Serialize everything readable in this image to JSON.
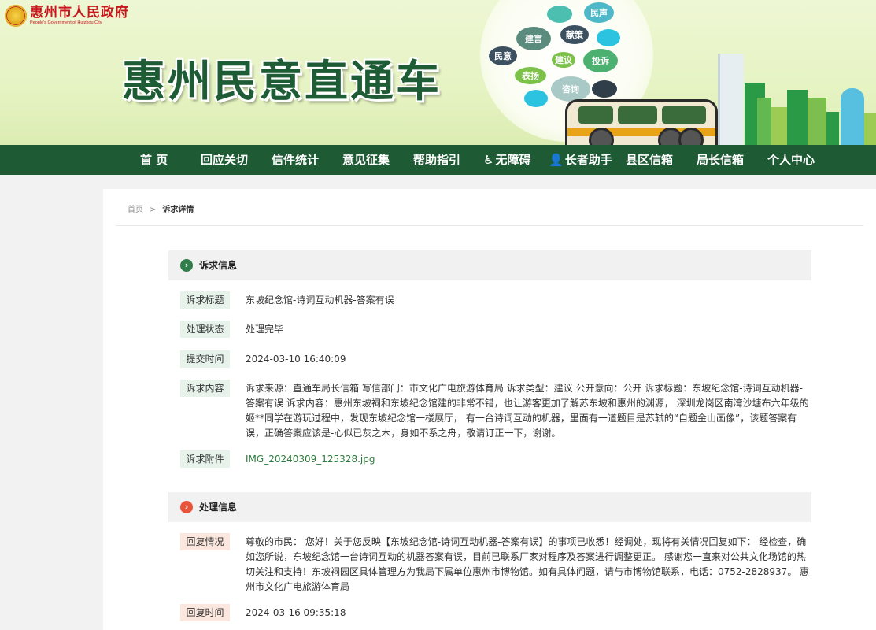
{
  "header": {
    "gov_name_cn": "惠州市人民政府",
    "gov_name_en": "People's Government of Huizhou City",
    "site_title": "惠州民意直通车",
    "bubbles": [
      "民声",
      "建言",
      "献策",
      "民意",
      "建议",
      "投诉",
      "表扬",
      "咨询"
    ]
  },
  "nav": {
    "items": [
      "首 页",
      "回应关切",
      "信件统计",
      "意见征集",
      "帮助指引",
      "无障碍",
      "长者助手",
      "县区信箱",
      "局长信箱",
      "个人中心"
    ]
  },
  "breadcrumb": {
    "home": "首页",
    "separator": ">",
    "current": "诉求详情"
  },
  "appeal": {
    "section_title": "诉求信息",
    "title_label": "诉求标题",
    "title_value": "东坡纪念馆-诗词互动机器-答案有误",
    "status_label": "处理状态",
    "status_value": "处理完毕",
    "submit_label": "提交时间",
    "submit_value": "2024-03-10 16:40:09",
    "content_label": "诉求内容",
    "content_value": "诉求来源：直通车局长信箱 写信部门：市文化广电旅游体育局 诉求类型：建议 公开意向：公开 诉求标题：东坡纪念馆-诗词互动机器-答案有误 诉求内容：惠州东坡祠和东坡纪念馆建的非常不错，也让游客更加了解苏东坡和惠州的渊源， 深圳龙岗区南湾沙塘布六年级的姬**同学在游玩过程中，发现东坡纪念馆一楼展厅， 有一台诗词互动的机器，里面有一道题目是苏轼的“自题金山画像”，该题答案有误，正确答案应该是-心似已灰之木，身如不系之舟，敬请订正一下，谢谢。",
    "attachment_label": "诉求附件",
    "attachment_value": "IMG_20240309_125328.jpg"
  },
  "handling": {
    "section_title": "处理信息",
    "reply_label": "回复情况",
    "reply_value": "尊敬的市民： 您好！关于您反映【东坡纪念馆-诗词互动机器-答案有误】的事项已收悉！经调处，现将有关情况回复如下： 经检查，确如您所说，东坡纪念馆一台诗词互动的机器答案有误，目前已联系厂家对程序及答案进行调整更正。 感谢您一直来对公共文化场馆的热切关注和支持！东坡祠园区具体管理方为我局下属单位惠州市博物馆。如有具体问题，请与市博物馆联系，电话：0752-2828937。 惠州市文化广电旅游体育局",
    "reply_time_label": "回复时间",
    "reply_time_value": "2024-03-16 09:35:18"
  },
  "colors": {
    "nav_bg": "#1e5b35",
    "title_green": "#1d5c34",
    "gov_red": "#c8161d",
    "appeal_icon": "#2f7d4a",
    "handling_icon": "#e8533a",
    "link": "#2a7a3b"
  }
}
